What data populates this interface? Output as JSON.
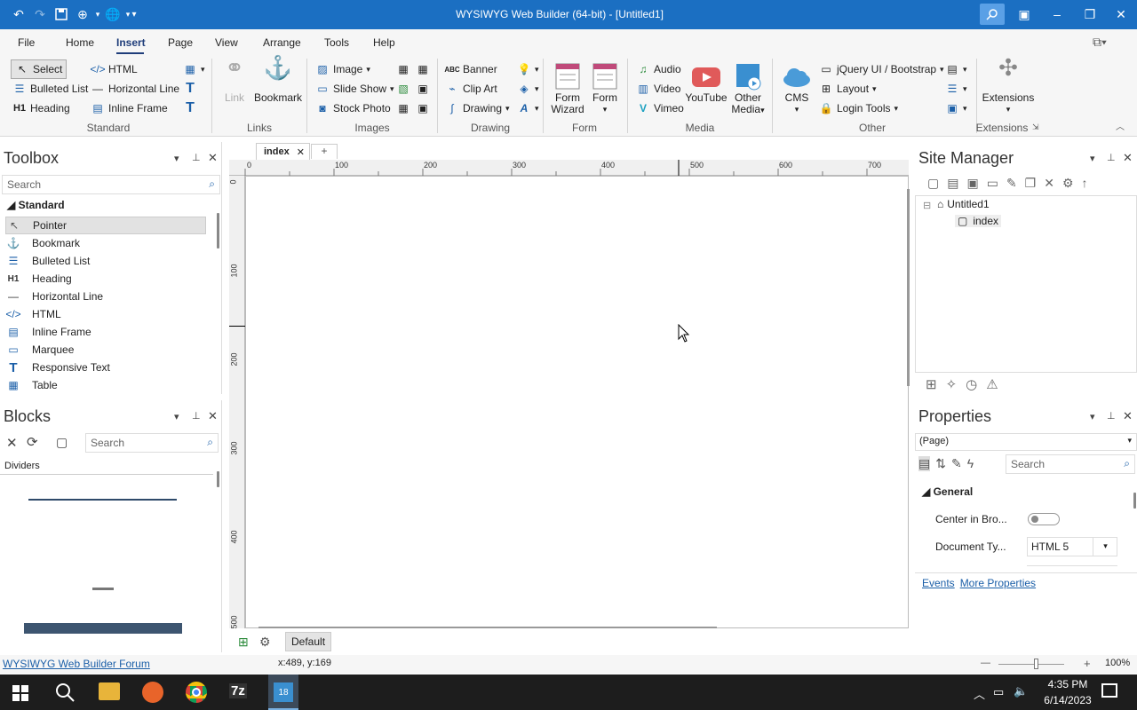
{
  "window": {
    "title": "WYSIWYG Web Builder (64-bit) - [Untitled1]"
  },
  "menu": [
    "File",
    "Home",
    "Insert",
    "Page",
    "View",
    "Arrange",
    "Tools",
    "Help"
  ],
  "ribbon": {
    "standard": {
      "select": "Select",
      "html": "HTML",
      "bulleted_list": "Bulleted List",
      "horizontal_line": "Horizontal Line",
      "heading": "Heading",
      "inline_frame": "Inline Frame",
      "group": "Standard"
    },
    "links": {
      "link": "Link",
      "bookmark": "Bookmark",
      "group": "Links"
    },
    "images": {
      "image": "Image",
      "slide_show": "Slide Show",
      "stock_photo": "Stock Photo",
      "group": "Images"
    },
    "drawing": {
      "banner": "Banner",
      "clip_art": "Clip Art",
      "drawing": "Drawing",
      "group": "Drawing"
    },
    "form": {
      "form_wizard_1": "Form",
      "form_wizard_2": "Wizard",
      "form": "Form",
      "group": "Form"
    },
    "media": {
      "audio": "Audio",
      "video": "Video",
      "vimeo": "Vimeo",
      "youtube": "YouTube",
      "other_1": "Other",
      "other_2": "Media",
      "group": "Media"
    },
    "other": {
      "cms": "CMS",
      "jquery": "jQuery UI / Bootstrap",
      "layout": "Layout",
      "login": "Login Tools",
      "group": "Other"
    },
    "extensions": {
      "label": "Extensions",
      "group": "Extensions"
    }
  },
  "toolbox": {
    "title": "Toolbox",
    "search": "Search",
    "category": "Standard",
    "items": [
      {
        "label": "Pointer",
        "icon": "pointer-icon"
      },
      {
        "label": "Bookmark",
        "icon": "anchor-icon"
      },
      {
        "label": "Bulleted List",
        "icon": "list-icon"
      },
      {
        "label": "Heading",
        "icon": "heading-icon"
      },
      {
        "label": "Horizontal Line",
        "icon": "line-icon"
      },
      {
        "label": "HTML",
        "icon": "code-icon"
      },
      {
        "label": "Inline Frame",
        "icon": "frame-icon"
      },
      {
        "label": "Marquee",
        "icon": "marquee-icon"
      },
      {
        "label": "Responsive Text",
        "icon": "text-icon"
      },
      {
        "label": "Table",
        "icon": "table-icon"
      }
    ]
  },
  "blocks": {
    "title": "Blocks",
    "search": "Search",
    "category": "Dividers"
  },
  "document": {
    "tab": "index",
    "ruler_h": [
      "0",
      "100",
      "200",
      "300",
      "400",
      "500",
      "600",
      "700"
    ],
    "ruler_v": [
      "0",
      "100",
      "200",
      "300",
      "400",
      "500"
    ],
    "master": "Default"
  },
  "site_manager": {
    "title": "Site Manager",
    "root": "Untitled1",
    "page": "index"
  },
  "properties": {
    "title": "Properties",
    "selector": "(Page)",
    "search": "Search",
    "section": "General",
    "center_label": "Center in Bro...",
    "doctype_label": "Document Ty...",
    "doctype_value": "HTML 5",
    "events": "Events",
    "more": "More Properties"
  },
  "status": {
    "forum": "WYSIWYG Web Builder Forum",
    "coords": "x:489, y:169",
    "zoom": "100%"
  },
  "taskbar": {
    "time": "4:35 PM",
    "date": "6/14/2023"
  },
  "colors": {
    "titlebar": "#1b6fc2",
    "accent": "#1b5fa8"
  }
}
